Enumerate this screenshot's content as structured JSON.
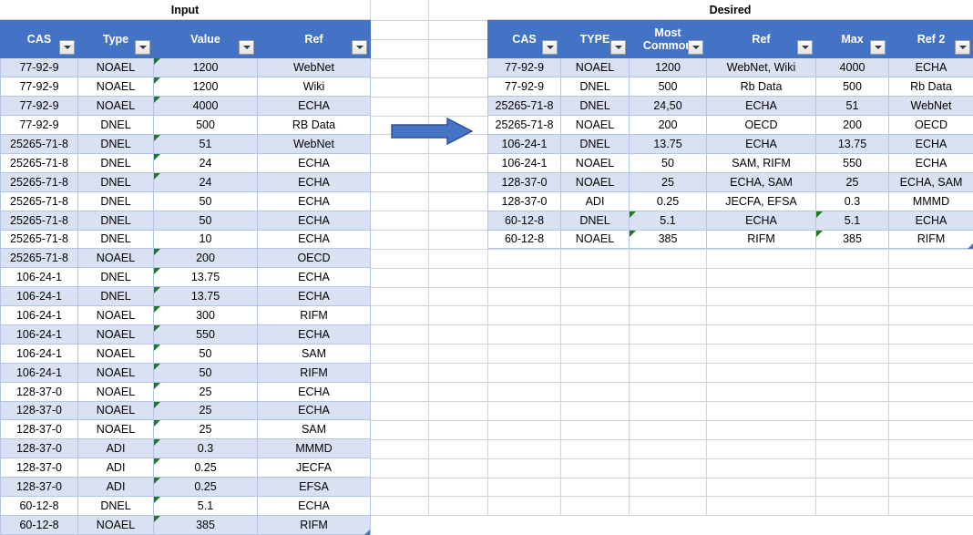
{
  "app": {
    "kind": "spreadsheet-worksheet",
    "accent_header_color": "#4472C4",
    "band_row_color": "#D9E1F2",
    "cell_border_color": "#B4C6E7",
    "gridline_color": "#D4D4D4",
    "arrow_fill": "#4472C4",
    "arrow_border": "#2F528F",
    "error_triangle_color": "#1F7A1F"
  },
  "left_table": {
    "title": "Input",
    "columns": [
      "CAS",
      "Type",
      "Value",
      "Ref"
    ],
    "filter_icon": "chevron-down-icon",
    "rows": [
      {
        "cas": "77-92-9",
        "type": "NOAEL",
        "value": "1200",
        "ref": "WebNet",
        "flag": true
      },
      {
        "cas": "77-92-9",
        "type": "NOAEL",
        "value": "1200",
        "ref": "Wiki",
        "flag": true
      },
      {
        "cas": "77-92-9",
        "type": "NOAEL",
        "value": "4000",
        "ref": "ECHA",
        "flag": true
      },
      {
        "cas": "77-92-9",
        "type": "DNEL",
        "value": "500",
        "ref": "RB Data",
        "flag": false
      },
      {
        "cas": "25265-71-8",
        "type": "DNEL",
        "value": "51",
        "ref": "WebNet",
        "flag": true
      },
      {
        "cas": "25265-71-8",
        "type": "DNEL",
        "value": "24",
        "ref": "ECHA",
        "flag": true
      },
      {
        "cas": "25265-71-8",
        "type": "DNEL",
        "value": "24",
        "ref": "ECHA",
        "flag": true
      },
      {
        "cas": "25265-71-8",
        "type": "DNEL",
        "value": "50",
        "ref": "ECHA",
        "flag": false
      },
      {
        "cas": "25265-71-8",
        "type": "DNEL",
        "value": "50",
        "ref": "ECHA",
        "flag": false
      },
      {
        "cas": "25265-71-8",
        "type": "DNEL",
        "value": "10",
        "ref": "ECHA",
        "flag": false
      },
      {
        "cas": "25265-71-8",
        "type": "NOAEL",
        "value": "200",
        "ref": "OECD",
        "flag": true
      },
      {
        "cas": "106-24-1",
        "type": "DNEL",
        "value": "13.75",
        "ref": "ECHA",
        "flag": true
      },
      {
        "cas": "106-24-1",
        "type": "DNEL",
        "value": "13.75",
        "ref": "ECHA",
        "flag": true
      },
      {
        "cas": "106-24-1",
        "type": "NOAEL",
        "value": "300",
        "ref": "RIFM",
        "flag": true
      },
      {
        "cas": "106-24-1",
        "type": "NOAEL",
        "value": "550",
        "ref": "ECHA",
        "flag": true
      },
      {
        "cas": "106-24-1",
        "type": "NOAEL",
        "value": "50",
        "ref": "SAM",
        "flag": true
      },
      {
        "cas": "106-24-1",
        "type": "NOAEL",
        "value": "50",
        "ref": "RIFM",
        "flag": true
      },
      {
        "cas": "128-37-0",
        "type": "NOAEL",
        "value": "25",
        "ref": "ECHA",
        "flag": true
      },
      {
        "cas": "128-37-0",
        "type": "NOAEL",
        "value": "25",
        "ref": "ECHA",
        "flag": true
      },
      {
        "cas": "128-37-0",
        "type": "NOAEL",
        "value": "25",
        "ref": "SAM",
        "flag": true
      },
      {
        "cas": "128-37-0",
        "type": "ADI",
        "value": "0.3",
        "ref": "MMMD",
        "flag": true
      },
      {
        "cas": "128-37-0",
        "type": "ADI",
        "value": "0.25",
        "ref": "JECFA",
        "flag": true
      },
      {
        "cas": "128-37-0",
        "type": "ADI",
        "value": "0.25",
        "ref": "EFSA",
        "flag": true
      },
      {
        "cas": "60-12-8",
        "type": "DNEL",
        "value": "5.1",
        "ref": "ECHA",
        "flag": true
      },
      {
        "cas": "60-12-8",
        "type": "NOAEL",
        "value": "385",
        "ref": "RIFM",
        "flag": true
      }
    ]
  },
  "right_table": {
    "title": "Desired",
    "columns": [
      "CAS",
      "TYPE",
      "Most Common",
      "Ref",
      "Max",
      "Ref 2"
    ],
    "filter_icon": "chevron-down-icon",
    "rows": [
      {
        "cas": "77-92-9",
        "type": "NOAEL",
        "most_common": "1200",
        "ref": "WebNet, Wiki",
        "max": "4000",
        "ref2": "ECHA",
        "flag_common": false,
        "flag_max": false
      },
      {
        "cas": "77-92-9",
        "type": "DNEL",
        "most_common": "500",
        "ref": "Rb Data",
        "max": "500",
        "ref2": "Rb Data",
        "flag_common": false,
        "flag_max": false
      },
      {
        "cas": "25265-71-8",
        "type": "DNEL",
        "most_common": "24,50",
        "ref": "ECHA",
        "max": "51",
        "ref2": "WebNet",
        "flag_common": false,
        "flag_max": false
      },
      {
        "cas": "25265-71-8",
        "type": "NOAEL",
        "most_common": "200",
        "ref": "OECD",
        "max": "200",
        "ref2": "OECD",
        "flag_common": false,
        "flag_max": false
      },
      {
        "cas": "106-24-1",
        "type": "DNEL",
        "most_common": "13.75",
        "ref": "ECHA",
        "max": "13.75",
        "ref2": "ECHA",
        "flag_common": false,
        "flag_max": false
      },
      {
        "cas": "106-24-1",
        "type": "NOAEL",
        "most_common": "50",
        "ref": "SAM, RIFM",
        "max": "550",
        "ref2": "ECHA",
        "flag_common": false,
        "flag_max": false
      },
      {
        "cas": "128-37-0",
        "type": "NOAEL",
        "most_common": "25",
        "ref": "ECHA, SAM",
        "max": "25",
        "ref2": "ECHA, SAM",
        "flag_common": false,
        "flag_max": false
      },
      {
        "cas": "128-37-0",
        "type": "ADI",
        "most_common": "0.25",
        "ref": "JECFA, EFSA",
        "max": "0.3",
        "ref2": "MMMD",
        "flag_common": false,
        "flag_max": false
      },
      {
        "cas": "60-12-8",
        "type": "DNEL",
        "most_common": "5.1",
        "ref": "ECHA",
        "max": "5.1",
        "ref2": "ECHA",
        "flag_common": true,
        "flag_max": true
      },
      {
        "cas": "60-12-8",
        "type": "NOAEL",
        "most_common": "385",
        "ref": "RIFM",
        "max": "385",
        "ref2": "RIFM",
        "flag_common": true,
        "flag_max": true
      }
    ]
  },
  "arrow": {
    "name": "transform-arrow",
    "direction": "right"
  }
}
